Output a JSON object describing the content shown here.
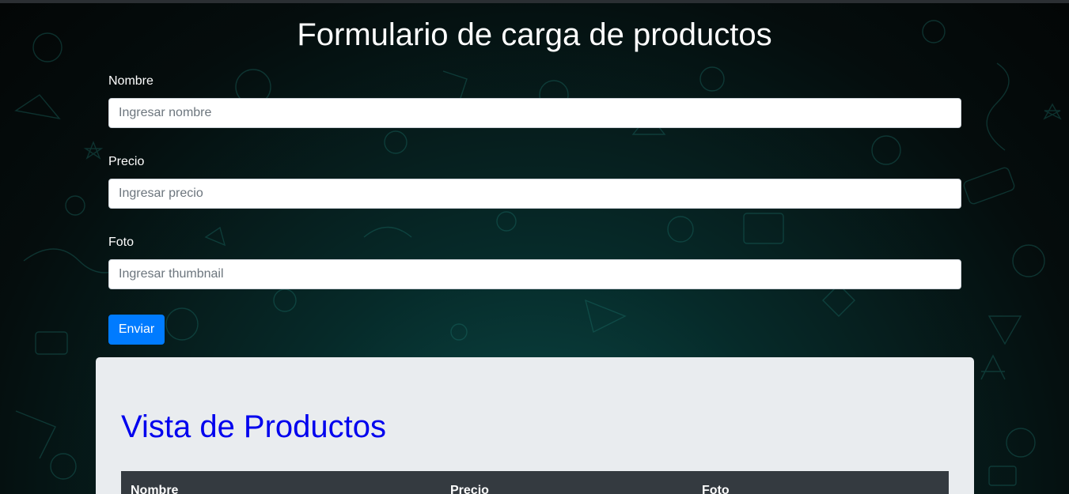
{
  "header": {
    "title": "Formulario de carga de productos"
  },
  "form": {
    "fields": [
      {
        "label": "Nombre",
        "placeholder": "Ingresar nombre"
      },
      {
        "label": "Precio",
        "placeholder": "Ingresar precio"
      },
      {
        "label": "Foto",
        "placeholder": "Ingresar thumbnail"
      }
    ],
    "submit_label": "Enviar"
  },
  "products": {
    "title": "Vista de Productos",
    "columns": [
      "Nombre",
      "Precio",
      "Foto"
    ]
  },
  "colors": {
    "accent": "#007bff",
    "title_link": "#0000ee",
    "table_header": "#343a40",
    "panel_bg": "#e9ecef"
  }
}
